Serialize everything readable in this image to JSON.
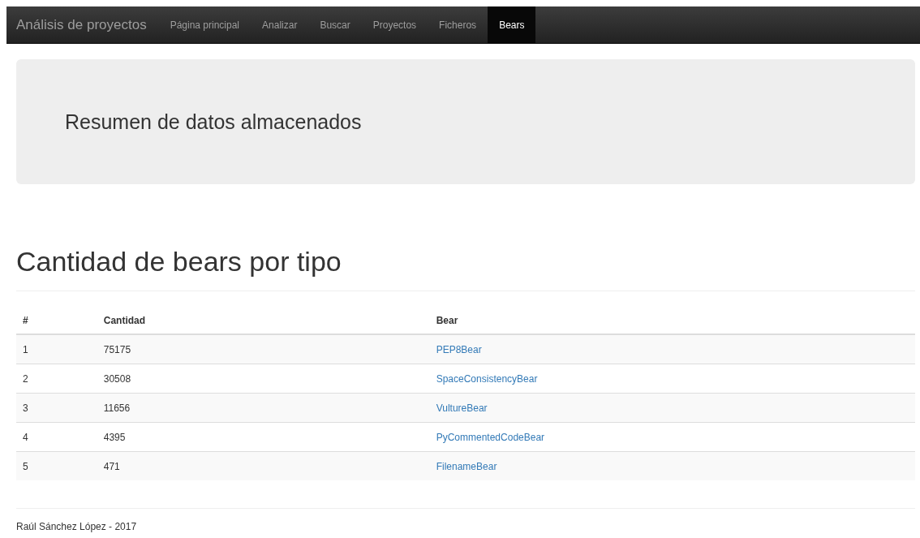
{
  "navbar": {
    "brand": "Análisis de proyectos",
    "items": [
      {
        "label": "Página principal",
        "selected": false
      },
      {
        "label": "Analizar",
        "selected": false
      },
      {
        "label": "Buscar",
        "selected": false
      },
      {
        "label": "Proyectos",
        "selected": false
      },
      {
        "label": "Ficheros",
        "selected": false
      },
      {
        "label": "Bears",
        "selected": true
      }
    ]
  },
  "jumbotron": {
    "title": "Resumen de datos almacenados"
  },
  "section": {
    "title": "Cantidad de bears por tipo"
  },
  "table": {
    "columns": [
      "#",
      "Cantidad",
      "Bear"
    ],
    "rows": [
      [
        "1",
        "75175",
        "PEP8Bear"
      ],
      [
        "2",
        "30508",
        "SpaceConsistencyBear"
      ],
      [
        "3",
        "11656",
        "VultureBear"
      ],
      [
        "4",
        "4395",
        "PyCommentedCodeBear"
      ],
      [
        "5",
        "471",
        "FilenameBear"
      ]
    ]
  },
  "footer": {
    "text": "Raúl Sánchez López - 2017"
  }
}
